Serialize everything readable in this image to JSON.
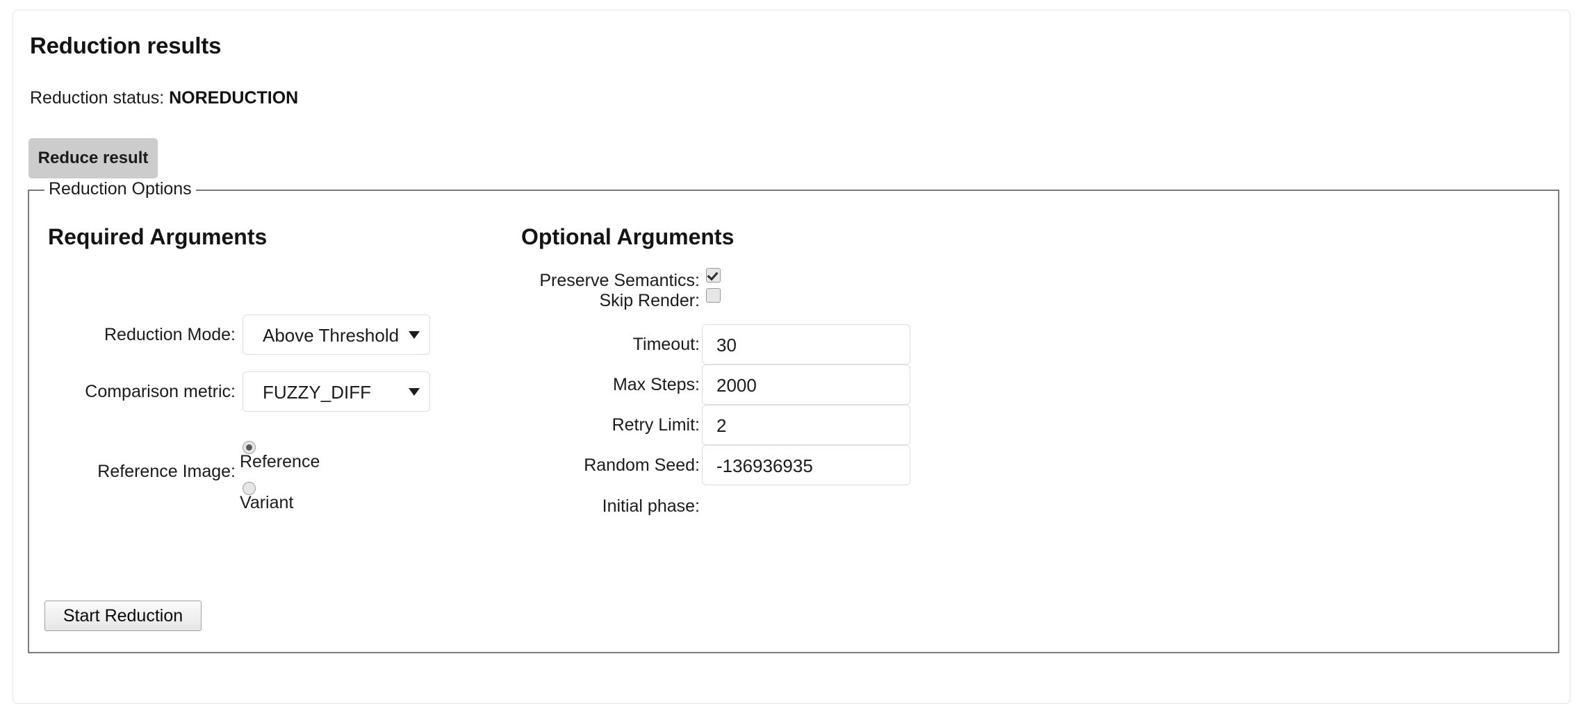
{
  "panel": {
    "title": "Reduction results",
    "status_label": "Reduction status:",
    "status_value": "NOREDUCTION",
    "reduce_result_label": "Reduce result"
  },
  "fieldset": {
    "legend": "Reduction Options"
  },
  "required": {
    "heading": "Required Arguments",
    "reduction_mode": {
      "label": "Reduction Mode:",
      "value": "Above Threshold"
    },
    "comparison_metric": {
      "label": "Comparison metric:",
      "value": "FUZZY_DIFF"
    },
    "reference_image": {
      "label": "Reference Image:",
      "option_reference": "Reference",
      "option_variant": "Variant",
      "selected": "Reference"
    }
  },
  "optional": {
    "heading": "Optional Arguments",
    "preserve_semantics": {
      "label": "Preserve Semantics:",
      "checked": true
    },
    "skip_render": {
      "label": "Skip Render:",
      "checked": false
    },
    "timeout": {
      "label": "Timeout:",
      "value": "30"
    },
    "max_steps": {
      "label": "Max Steps:",
      "value": "2000"
    },
    "retry_limit": {
      "label": "Retry Limit:",
      "value": "2"
    },
    "random_seed": {
      "label": "Random Seed:",
      "value": "-136936935"
    },
    "initial_phase": {
      "label": "Initial phase:",
      "value": ""
    }
  },
  "actions": {
    "start_reduction_label": "Start Reduction"
  },
  "colors": {
    "card_border": "#e3e3e3",
    "fieldset_border": "#7a7a7a",
    "reduce_button_bg": "#cccccc",
    "input_border": "#dedede",
    "text": "#1b1b1b"
  }
}
